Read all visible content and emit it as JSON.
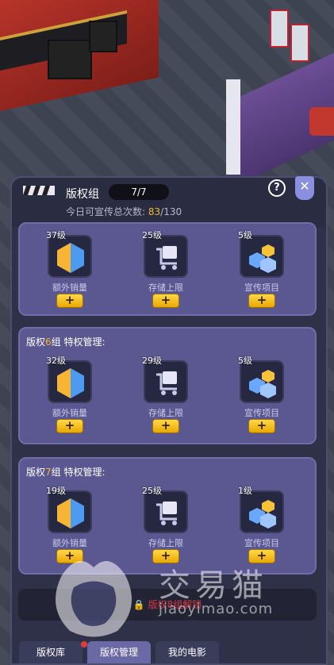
{
  "panel": {
    "title": "版权组",
    "count": "7/7",
    "promo_label": "今日可宣传总次数:",
    "promo_used": "83",
    "promo_total": "/130",
    "help_label": "?",
    "close_label": "✕"
  },
  "groups": [
    {
      "title_prefix": "",
      "title_num": "",
      "title_suffix": "",
      "items": [
        {
          "level": "37级",
          "name": "额外销量",
          "plus": "+"
        },
        {
          "level": "25级",
          "name": "存储上限",
          "plus": "+"
        },
        {
          "level": "5级",
          "name": "宣传项目",
          "plus": "+"
        }
      ]
    },
    {
      "title_prefix": "版权",
      "title_num": "6",
      "title_suffix": "组 特权管理:",
      "items": [
        {
          "level": "32级",
          "name": "额外销量",
          "plus": "+"
        },
        {
          "level": "29级",
          "name": "存储上限",
          "plus": "+"
        },
        {
          "level": "5级",
          "name": "宣传项目",
          "plus": "+"
        }
      ]
    },
    {
      "title_prefix": "版权",
      "title_num": "7",
      "title_suffix": "组 特权管理:",
      "items": [
        {
          "level": "19级",
          "name": "额外销量",
          "plus": "+"
        },
        {
          "level": "25级",
          "name": "存储上限",
          "plus": "+"
        },
        {
          "level": "1级",
          "name": "宣传项目",
          "plus": "+"
        }
      ]
    }
  ],
  "locked_text": "版权8组解锁",
  "tabs": [
    {
      "label": "版权库"
    },
    {
      "label": "版权管理"
    },
    {
      "label": "我的电影"
    }
  ],
  "watermark": {
    "text": "交易猫",
    "url": "jiaoyimao.com"
  },
  "colors": {
    "accent": "#f2b632",
    "panel_bg": "#2f3149",
    "group_bg": "#5b5891",
    "locked_text": "#d6383f"
  },
  "icons": {
    "sales": "hexagon-sales-icon",
    "storage": "cart-storage-icon",
    "promo": "bubbles-promo-icon"
  }
}
